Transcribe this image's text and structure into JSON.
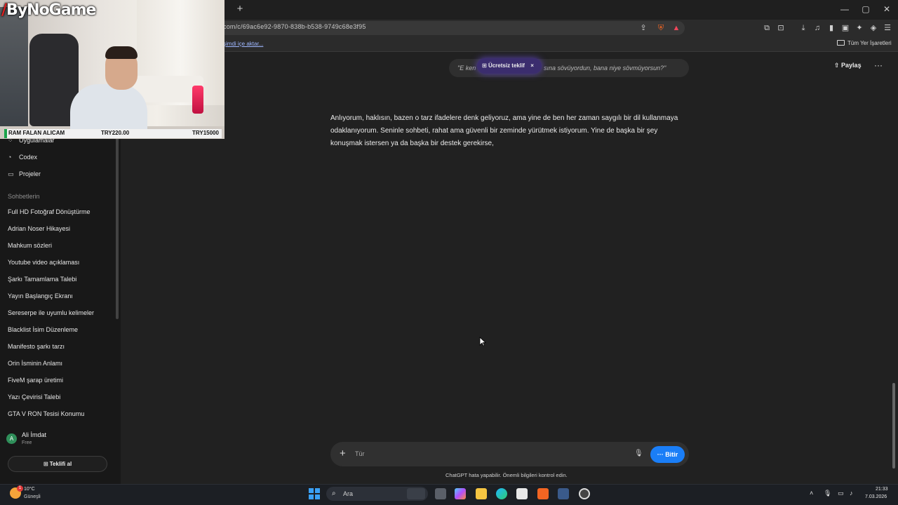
{
  "browser": {
    "url": "com/c/69ac6e92-9870-838b-b538-9749c68e3f95",
    "import_link": "şimdi içe aktar...",
    "all_bookmarks": "Tüm Yer İşaretleri"
  },
  "webcam": {
    "logo_text": "ByNoGame",
    "ticker": {
      "item": "RAM FALAN ALICAM",
      "current": "TRY220.00",
      "goal": "TRY15000"
    }
  },
  "sidebar": {
    "nav": [
      {
        "label": "Uygulamalar",
        "icon": "apps-icon"
      },
      {
        "label": "Codex",
        "icon": "codex-icon"
      },
      {
        "label": "Projeler",
        "icon": "folder-icon"
      }
    ],
    "chats_header": "Sohbetlerin",
    "chats": [
      "Full HD Fotoğraf Dönüştürme",
      "Adrian Noser Hikayesi",
      "Mahkum sözleri",
      "Youtube video açıklaması",
      "Şarkı Tamamlama Talebi",
      "Yayın Başlangıç Ekranı",
      "Sereserpe ile uyumlu kelimeler",
      "Blacklist İsim Düzenleme",
      "Manifesto şarkı tarzı",
      "Orin İsminin Anlamı",
      "FiveM şarap üretimi",
      "Yazı Çevirisi Talebi",
      "GTA V RON Tesisi Konumu"
    ],
    "user": {
      "avatar_letter": "A",
      "name": "Ali İmdat",
      "plan": "Free"
    },
    "offer_button": "Teklifi al"
  },
  "main": {
    "quote_left": "\"E ken",
    "quote_right": "sına sövüyordun, bana niye sövmüyorsun?\"",
    "offer_pill": "Ücretsiz teklif",
    "offer_close": "×",
    "share_label": "Paylaş",
    "more_label": "···",
    "answer": "Anlıyorum, haklısın, bazen o tarz ifadelere denk geliyoruz, ama yine de ben her zaman saygılı bir dil kullanmaya odaklanıyorum. Seninle sohbeti, rahat ama güvenli bir zeminde yürütmek istiyorum. Yine de başka bir şey konuşmak istersen ya da başka bir destek gerekirse,",
    "composer_placeholder": "Tür",
    "finish_button": "Bitir",
    "disclaimer": "ChatGPT hata yapabilir. Önemli bilgileri kontrol edin."
  },
  "taskbar": {
    "weather_temp": "10°C",
    "weather_desc": "Güneşli",
    "weather_badge": "1",
    "search_placeholder": "Ara",
    "time": "21:33",
    "date": "7.03.2026"
  },
  "colors": {
    "accent_blue": "#1a7ef7",
    "offer_purple": "#3b2d6e",
    "background": "#212121",
    "sidebar": "#181818"
  }
}
